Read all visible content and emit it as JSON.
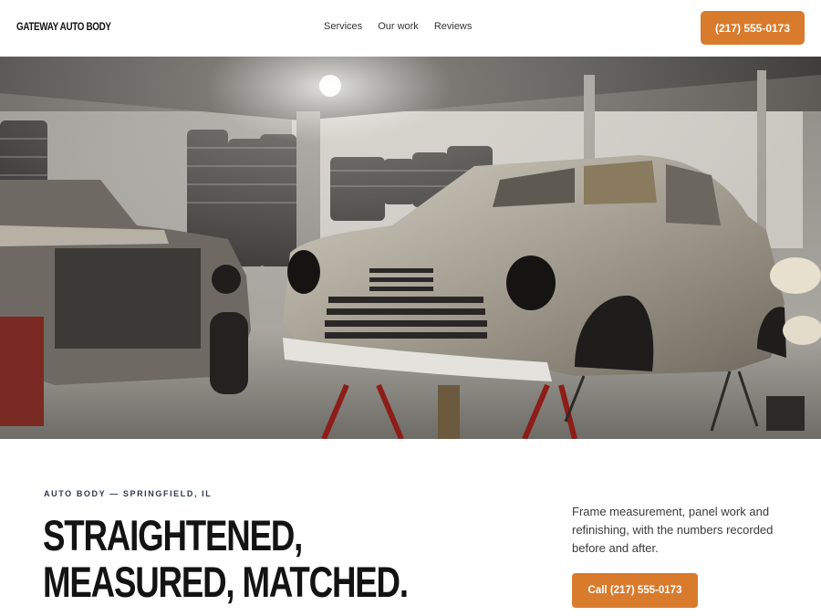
{
  "header": {
    "logo_text": "GATEWAY AUTO BODY",
    "nav": [
      {
        "label": "Services"
      },
      {
        "label": "Our work"
      },
      {
        "label": "Reviews"
      }
    ],
    "cta_label": "(217) 555-0173"
  },
  "hero": {
    "image_subject": "garage-with-stripped-vintage-car-bodies"
  },
  "content": {
    "eyebrow": "AUTO BODY — SPRINGFIELD, IL",
    "headline_line1": "STRAIGHTENED,",
    "headline_line2": "MEASURED, MATCHED.",
    "description": "Frame measurement, panel work and refinishing, with the numbers recorded before and after.",
    "cta_label": "Call (217) 555-0173"
  },
  "colors": {
    "accent": "#d97b2d",
    "text_dark": "#131313",
    "eyebrow": "#2f3b4a"
  }
}
